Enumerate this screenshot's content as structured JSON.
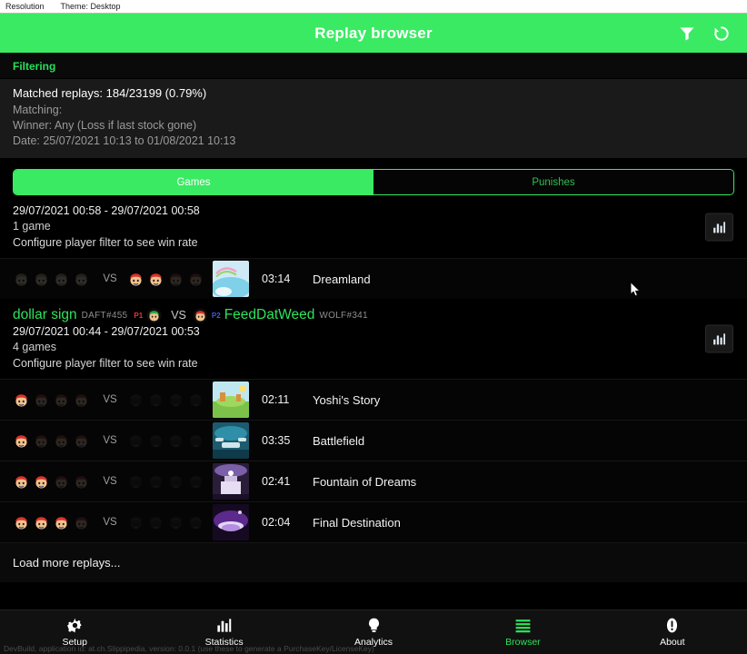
{
  "os_bar": {
    "resolution_label": "Resolution",
    "theme_label": "Theme: Desktop"
  },
  "header": {
    "title": "Replay browser",
    "filter_icon": "filter-funnel-icon",
    "refresh_icon": "refresh-icon",
    "accent": "#3bea63"
  },
  "filtering": {
    "section_title": "Filtering",
    "matched": "Matched replays: 184/23199 (0.79%)",
    "matching_label": "Matching:",
    "winner": "Winner: Any (Loss if last stock gone)",
    "date": "Date: 25/07/2021 10:13 to 01/08/2021 10:13"
  },
  "tabs": [
    {
      "label": "Games",
      "active": true
    },
    {
      "label": "Punishes",
      "active": false
    }
  ],
  "groups": [
    {
      "has_players_line": false,
      "date_range": "29/07/2021 00:58 - 29/07/2021 00:58",
      "count": "1 game",
      "note": "Configure player filter to see win rate",
      "chart_button": "bar-chart-icon",
      "rows": [
        {
          "left_char": "fox",
          "left_stocks": 0,
          "left_total": 4,
          "right_char": "mario",
          "right_stocks": 2,
          "right_total": 4,
          "vs": "VS",
          "duration": "03:14",
          "stage": "Dreamland",
          "stage_key": "dreamland"
        }
      ]
    },
    {
      "has_players_line": true,
      "player_left_name": "dollar sign",
      "player_left_tag": "DAFT#455",
      "player_left_badge": "P1",
      "player_left_char": "luigi",
      "vs": "VS",
      "player_right_name": "FeedDatWeed",
      "player_right_tag": "WOLF#341",
      "player_right_badge": "P2",
      "player_right_char": "mario",
      "date_range": "29/07/2021 00:44 - 29/07/2021 00:53",
      "count": "4 games",
      "note": "Configure player filter to see win rate",
      "chart_button": "bar-chart-icon",
      "rows": [
        {
          "left_char": "mario",
          "left_stocks": 1,
          "left_total": 4,
          "right_char": "falcon",
          "right_stocks": 0,
          "right_total": 4,
          "vs": "VS",
          "duration": "02:11",
          "stage": "Yoshi's Story",
          "stage_key": "yoshis-story"
        },
        {
          "left_char": "mario",
          "left_stocks": 1,
          "left_total": 4,
          "right_char": "falcon",
          "right_stocks": 0,
          "right_total": 4,
          "vs": "VS",
          "duration": "03:35",
          "stage": "Battlefield",
          "stage_key": "battlefield"
        },
        {
          "left_char": "mario",
          "left_stocks": 2,
          "left_total": 4,
          "right_char": "falcon",
          "right_stocks": 0,
          "right_total": 4,
          "vs": "VS",
          "duration": "02:41",
          "stage": "Fountain of Dreams",
          "stage_key": "fountain-of-dreams"
        },
        {
          "left_char": "mario",
          "left_stocks": 3,
          "left_total": 4,
          "right_char": "falcon",
          "right_stocks": 0,
          "right_total": 4,
          "vs": "VS",
          "duration": "02:04",
          "stage": "Final Destination",
          "stage_key": "final-destination"
        }
      ]
    }
  ],
  "load_more": "Load more replays...",
  "nav": [
    {
      "label": "Setup",
      "icon": "gear-icon",
      "active": false
    },
    {
      "label": "Statistics",
      "icon": "bar-chart-icon",
      "active": false
    },
    {
      "label": "Analytics",
      "icon": "bulb-icon",
      "active": false
    },
    {
      "label": "Browser",
      "icon": "list-icon",
      "active": true
    },
    {
      "label": "About",
      "icon": "info-icon",
      "active": false
    }
  ],
  "status_line": "DevBuild, application id: at.ch.Slippipedia, version: 0.0.1 (use these to generate a PurchaseKey/LicenseKey)"
}
